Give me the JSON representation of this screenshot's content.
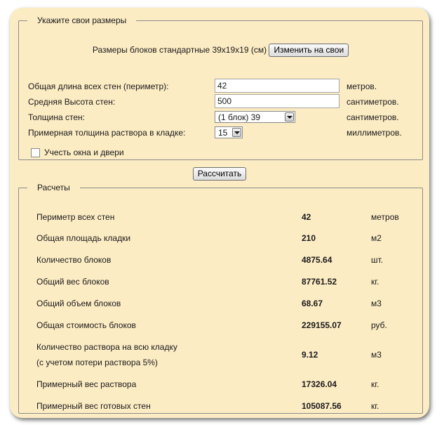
{
  "input_section": {
    "legend": "Укажите свои размеры",
    "standard_text": "Размеры блоков стандартные 39x19x19 (см)",
    "change_button": "Изменить на свои",
    "rows": [
      {
        "label": "Общая длина всех стен (периметр):",
        "value": "42",
        "unit": "метров."
      },
      {
        "label": "Средняя Высота стен:",
        "value": "500",
        "unit": "сантиметров."
      },
      {
        "label": "Толщина стен:",
        "value": "(1 блок) 39",
        "unit": "сантиметров."
      },
      {
        "label": "Примерная толщина раствора в кладке:",
        "value": "15",
        "unit": "миллиметров."
      }
    ],
    "checkbox_label": "Учесть окна и двери",
    "checkbox_checked": false
  },
  "calculate_button": "Рассчитать",
  "results_section": {
    "legend": "Расчеты",
    "rows": [
      {
        "label": "Периметр всех стен",
        "value": "42",
        "unit": "метров"
      },
      {
        "label": "Общая площадь кладки",
        "value": "210",
        "unit": "м2"
      },
      {
        "label": "Количество блоков",
        "value": "4875.64",
        "unit": "шт."
      },
      {
        "label": "Общий вес блоков",
        "value": "87761.52",
        "unit": "кг."
      },
      {
        "label": "Общий объем блоков",
        "value": "68.67",
        "unit": "м3"
      },
      {
        "label": "Общая стоимость блоков",
        "value": "229155.07",
        "unit": "руб."
      },
      {
        "label": "Количество раствора на всю кладку",
        "label2": "(с учетом потери раствора 5%)",
        "value": "9.12",
        "unit": "м3"
      },
      {
        "label": "Примерный вес раствора",
        "value": "17326.04",
        "unit": "кг."
      },
      {
        "label": "Примерный вес готовых стен",
        "value": "105087.56",
        "unit": "кг."
      }
    ]
  }
}
